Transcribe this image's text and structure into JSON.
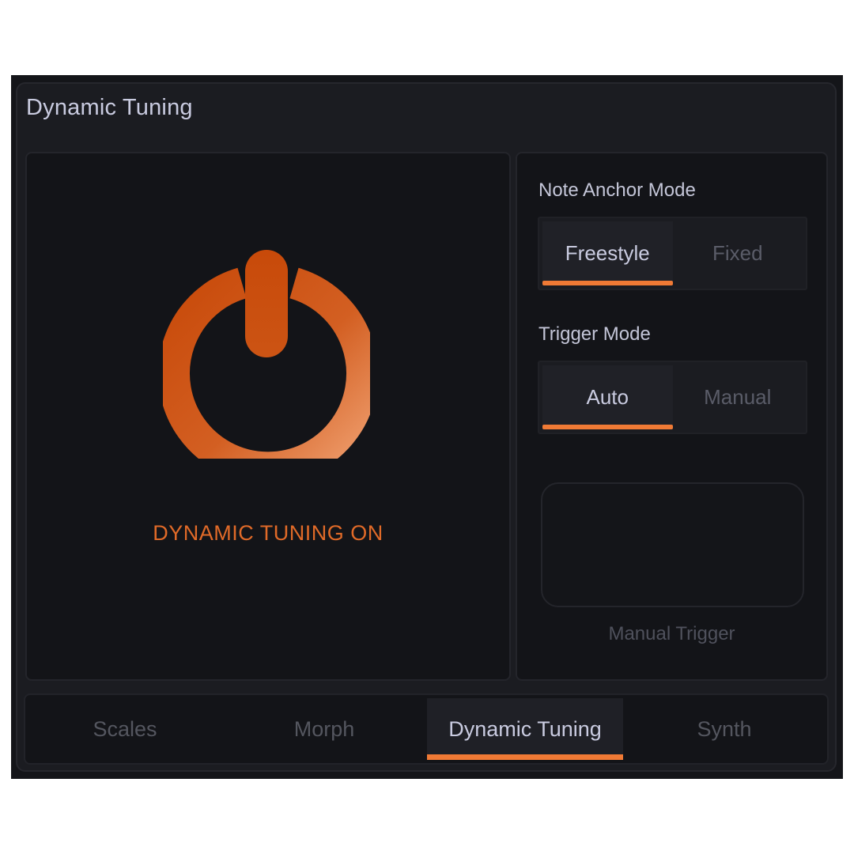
{
  "panel": {
    "title": "Dynamic Tuning"
  },
  "power": {
    "status": "DYNAMIC TUNING ON",
    "on": true,
    "accent": "#e06a28"
  },
  "note_anchor": {
    "label": "Note Anchor Mode",
    "options": [
      "Freestyle",
      "Fixed"
    ],
    "selected": "Freestyle"
  },
  "trigger_mode": {
    "label": "Trigger Mode",
    "options": [
      "Auto",
      "Manual"
    ],
    "selected": "Auto"
  },
  "manual_trigger": {
    "label": "Manual Trigger"
  },
  "tabs": {
    "items": [
      "Scales",
      "Morph",
      "Dynamic Tuning",
      "Synth"
    ],
    "selected": "Dynamic Tuning"
  },
  "colors": {
    "accent": "#f07a35",
    "background": "#141519",
    "text_primary": "#c9cbe0",
    "text_muted": "#54565f"
  },
  "icons": {
    "power": "power-icon"
  }
}
